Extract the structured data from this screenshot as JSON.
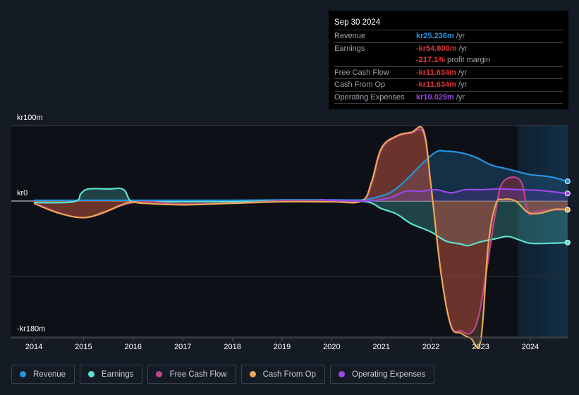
{
  "tooltip": {
    "date": "Sep 30 2024",
    "rows": [
      {
        "label": "Revenue",
        "value": "kr25.236m",
        "unit": "/yr",
        "color": "#2394df"
      },
      {
        "label": "Earnings",
        "value": "-kr54.800m",
        "unit": "/yr",
        "color": "#e2363a"
      },
      {
        "label": "",
        "value": "-217.1%",
        "unit": "profit margin",
        "color": "#e2363a"
      },
      {
        "label": "Free Cash Flow",
        "value": "-kr11.634m",
        "unit": "/yr",
        "color": "#e2363a"
      },
      {
        "label": "Cash From Op",
        "value": "-kr11.634m",
        "unit": "/yr",
        "color": "#e2363a"
      },
      {
        "label": "Operating Expenses",
        "value": "kr10.029m",
        "unit": "/yr",
        "color": "#9b47e6"
      }
    ]
  },
  "legend": [
    {
      "label": "Revenue",
      "color": "#2394df"
    },
    {
      "label": "Earnings",
      "color": "#5ce0cf"
    },
    {
      "label": "Free Cash Flow",
      "color": "#c0458a"
    },
    {
      "label": "Cash From Op",
      "color": "#e8a657"
    },
    {
      "label": "Operating Expenses",
      "color": "#9b47e6"
    }
  ],
  "chart_data": {
    "type": "line",
    "title": "",
    "xlabel": "",
    "ylabel": "",
    "ylim": [
      -180,
      100
    ],
    "xlim": [
      2013.7,
      2024.75
    ],
    "y_tick_labels": [
      {
        "value": 100,
        "label": "kr100m"
      },
      {
        "value": 0,
        "label": "kr0"
      },
      {
        "value": -180,
        "label": "-kr180m"
      }
    ],
    "x_tick_labels": [
      "2014",
      "2015",
      "2016",
      "2017",
      "2018",
      "2019",
      "2020",
      "2021",
      "2022",
      "2023",
      "2024"
    ],
    "highlight_from": 2023.75,
    "grid": "horizontal",
    "series": [
      {
        "name": "Revenue",
        "color": "#2394df",
        "x": [
          2014.0,
          2015.0,
          2016.0,
          2017.0,
          2018.0,
          2019.0,
          2020.0,
          2020.6,
          2020.9,
          2021.2,
          2021.5,
          2021.8,
          2022.1,
          2022.3,
          2022.6,
          2022.9,
          2023.2,
          2023.5,
          2023.8,
          2024.0,
          2024.4,
          2024.75
        ],
        "y": [
          1,
          1,
          1,
          1,
          1,
          1.5,
          1.5,
          1.5,
          5,
          12,
          28,
          48,
          65,
          66,
          64,
          58,
          48,
          43,
          38,
          35,
          32,
          26
        ]
      },
      {
        "name": "Earnings",
        "color": "#5ce0cf",
        "x": [
          2014.0,
          2014.8,
          2014.95,
          2015.1,
          2015.5,
          2015.8,
          2015.95,
          2016.2,
          2017.0,
          2018.0,
          2019.0,
          2020.0,
          2020.7,
          2021.0,
          2021.3,
          2021.6,
          2022.0,
          2022.3,
          2022.6,
          2022.75,
          2023.0,
          2023.3,
          2023.55,
          2023.8,
          2024.0,
          2024.4,
          2024.75
        ],
        "y": [
          -2,
          -1,
          10,
          16,
          16,
          15.5,
          0,
          -1,
          -1,
          -1,
          0,
          0,
          -1,
          -10,
          -17,
          -30,
          -41,
          -53,
          -57,
          -59,
          -54,
          -50,
          -47,
          -52,
          -56,
          -56,
          -55
        ]
      },
      {
        "name": "Free Cash Flow",
        "color": "#c0458a",
        "x": [
          2014.0,
          2015.0,
          2016.0,
          2017.0,
          2018.0,
          2019.0,
          2020.0,
          2020.6,
          2020.8,
          2021.0,
          2021.3,
          2021.6,
          2021.85,
          2022.0,
          2022.2,
          2022.4,
          2022.6,
          2022.8,
          2022.95,
          2023.1,
          2023.3,
          2023.45,
          2023.8,
          2023.95,
          2024.1,
          2024.4,
          2024.75
        ],
        "y": [
          -3,
          -22,
          -2,
          -4,
          -3,
          0,
          0,
          0,
          22,
          68,
          85,
          90,
          89,
          20,
          -95,
          -165,
          -172,
          -175,
          -155,
          -100,
          -15,
          25,
          27,
          -15,
          -14,
          -12,
          -11.6
        ]
      },
      {
        "name": "Cash From Op",
        "color": "#e8a657",
        "x": [
          2014.0,
          2014.5,
          2015.0,
          2015.4,
          2015.9,
          2016.2,
          2017.0,
          2018.0,
          2019.0,
          2020.0,
          2020.6,
          2020.8,
          2021.0,
          2021.3,
          2021.6,
          2021.85,
          2022.0,
          2022.2,
          2022.4,
          2022.6,
          2022.8,
          2023.0,
          2023.15,
          2023.3,
          2023.45,
          2023.7,
          2023.95,
          2024.2,
          2024.5,
          2024.75
        ],
        "y": [
          -3,
          -16,
          -22,
          -15,
          -2,
          -3,
          -5,
          -3,
          -1,
          -1,
          0,
          25,
          70,
          86,
          91,
          93,
          20,
          -95,
          -165,
          -175,
          -182,
          -185,
          -60,
          -5,
          2,
          0,
          -15,
          -16,
          -11,
          -11.6
        ]
      },
      {
        "name": "Operating Expenses",
        "color": "#9b47e6",
        "x": [
          2019.75,
          2020.0,
          2020.6,
          2020.9,
          2021.2,
          2021.5,
          2021.8,
          2022.1,
          2022.4,
          2022.7,
          2023.0,
          2023.4,
          2023.8,
          2024.2,
          2024.75
        ],
        "y": [
          2,
          1,
          0,
          1,
          5,
          13,
          13,
          15,
          11,
          15,
          15,
          16,
          15,
          14,
          10
        ]
      }
    ]
  }
}
